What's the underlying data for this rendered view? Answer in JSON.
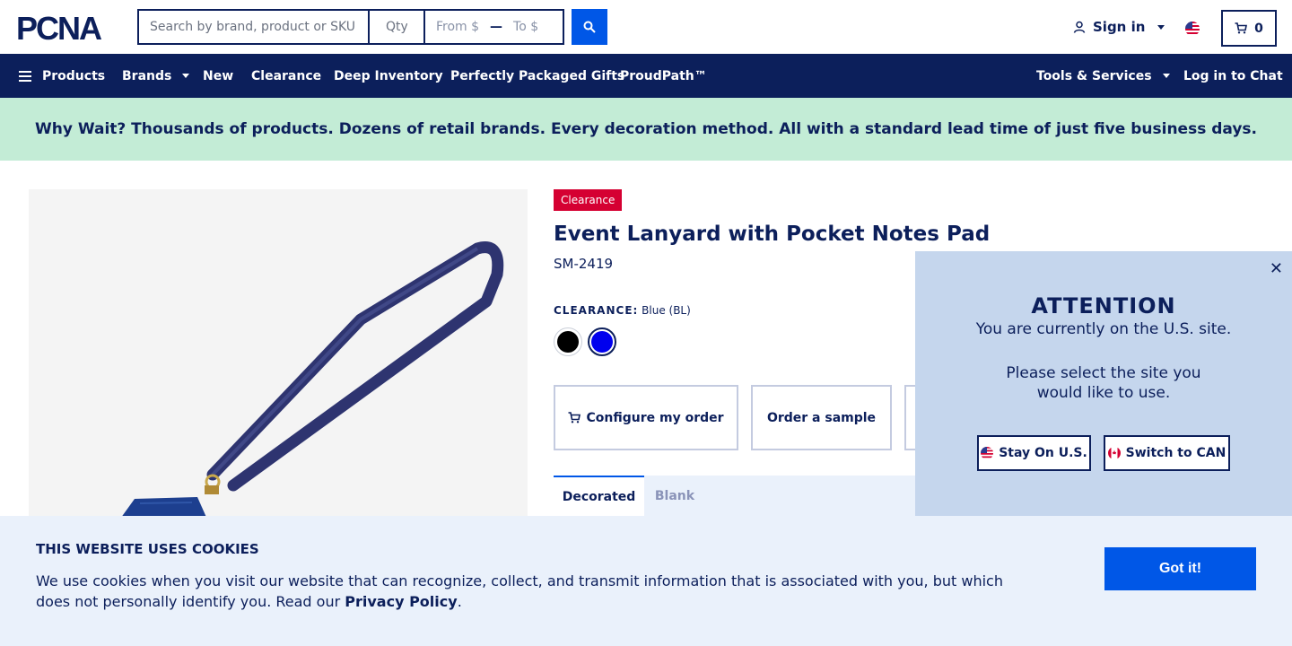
{
  "header": {
    "logo_text": "PCNA",
    "search_placeholder": "Search by brand, product or SKU",
    "qty_placeholder": "Qty",
    "price_from": "From $",
    "price_dash": "—",
    "price_to": "To $",
    "signin_label": "Sign in",
    "cart_count": "0"
  },
  "nav": {
    "items": [
      "Products",
      "Brands",
      "New",
      "Clearance",
      "Deep Inventory",
      "Perfectly Packaged Gifts",
      "ProudPath™"
    ],
    "tools": "Tools & Services",
    "chat": "Log in to Chat"
  },
  "banner": {
    "text": "Why Wait? Thousands of products. Dozens of retail brands. Every decoration method. All with a standard lead time of just five business days."
  },
  "product": {
    "badge": "Clearance",
    "title": "Event Lanyard with Pocket Notes Pad",
    "sku": "SM-2419",
    "color_label": "CLEARANCE:",
    "color_value": "Blue (BL)",
    "swatches": [
      {
        "name": "Black",
        "hex": "#000000"
      },
      {
        "name": "Blue",
        "hex": "#0000ee"
      }
    ],
    "configure_label": "Configure my order",
    "sample_label": "Order a sample",
    "tabs": [
      "Decorated",
      "Blank"
    ]
  },
  "popup": {
    "title": "ATTENTION",
    "message": "You are currently on the U.S. site.",
    "message2": "Please select the site you would like to use.",
    "stay_label": "Stay On U.S.",
    "switch_label": "Switch to CAN"
  },
  "cookie": {
    "title": "THIS WEBSITE USES COOKIES",
    "text": "We use cookies when you visit our website that can recognize, collect, and transmit information that is associated with you, but which does not personally identify you. Read our",
    "link": "Privacy Policy",
    "period": ".",
    "button": "Got it!"
  },
  "colors": {
    "navy": "#0c1f5b",
    "accent": "#0057e7",
    "clearance": "#d50032",
    "banner": "#c3ecd6"
  }
}
